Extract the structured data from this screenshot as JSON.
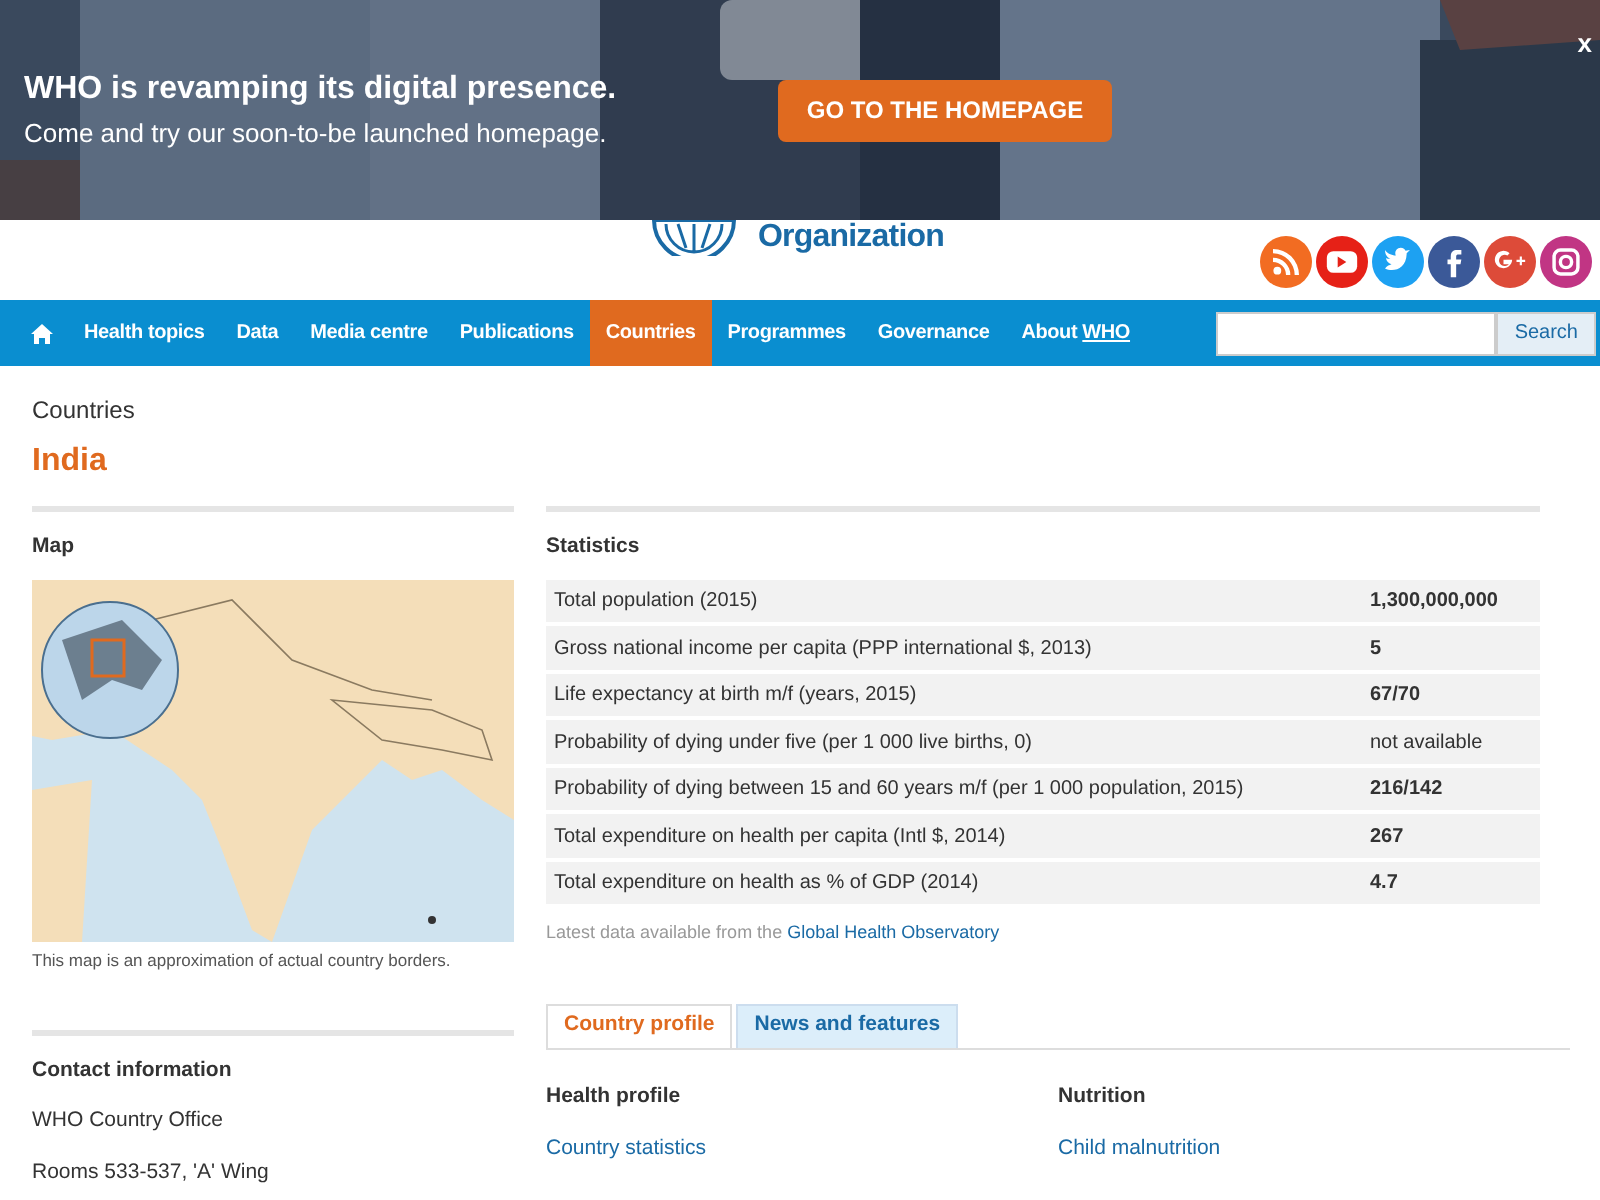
{
  "banner": {
    "headline": "WHO is revamping its digital presence.",
    "subline": "Come and try our soon-to-be launched homepage.",
    "button": "GO TO THE HOMEPAGE",
    "close": "x"
  },
  "header": {
    "logo_text": "Organization",
    "social": [
      {
        "kind": "rss",
        "color": "#f26c22"
      },
      {
        "kind": "youtube",
        "color": "#e62117"
      },
      {
        "kind": "twitter",
        "color": "#1da1f2"
      },
      {
        "kind": "facebook",
        "color": "#3b5998"
      },
      {
        "kind": "googleplus",
        "color": "#dd4b39"
      },
      {
        "kind": "instagram",
        "color": "#c13584"
      }
    ]
  },
  "nav": {
    "items": [
      {
        "label": "Health topics",
        "selected": false
      },
      {
        "label": "Data",
        "selected": false
      },
      {
        "label": "Media centre",
        "selected": false
      },
      {
        "label": "Publications",
        "selected": false
      },
      {
        "label": "Countries",
        "selected": true
      },
      {
        "label": "Programmes",
        "selected": false
      },
      {
        "label": "Governance",
        "selected": false
      },
      {
        "label": "About ",
        "label_underlined": "WHO",
        "selected": false
      }
    ],
    "search_button": "Search"
  },
  "breadcrumb": "Countries",
  "title": "India",
  "map": {
    "heading": "Map",
    "caption": "This map is an approximation of actual country borders."
  },
  "statistics": {
    "heading": "Statistics",
    "rows": [
      {
        "label": "Total population (2015)",
        "value": "1,300,000,000",
        "bold": true
      },
      {
        "label": "Gross national income per capita (PPP international $, 2013)",
        "value": "5",
        "bold": true
      },
      {
        "label": "Life expectancy at birth m/f (years, 2015)",
        "value": "67/70",
        "bold": true
      },
      {
        "label": "Probability of dying under five (per 1 000 live births, 0)",
        "value": "not available",
        "bold": false
      },
      {
        "label": "Probability of dying between 15 and 60 years m/f (per 1 000 population, 2015)",
        "value": "216/142",
        "bold": true
      },
      {
        "label": "Total expenditure on health per capita (Intl $, 2014)",
        "value": "267",
        "bold": true
      },
      {
        "label": "Total expenditure on health as % of GDP (2014)",
        "value": "4.7",
        "bold": true
      }
    ],
    "note": "Latest data available from the ",
    "note_link": "Global Health Observatory"
  },
  "contact": {
    "heading": "Contact information",
    "lines": [
      "WHO Country Office",
      "Rooms 533-537, 'A' Wing"
    ]
  },
  "tabs": [
    {
      "label": "Country profile",
      "selected": true
    },
    {
      "label": "News and features",
      "selected": false
    }
  ],
  "profile": [
    {
      "heading": "Health profile",
      "link": "Country statistics"
    },
    {
      "heading": "Nutrition",
      "link": "Child malnutrition"
    }
  ]
}
